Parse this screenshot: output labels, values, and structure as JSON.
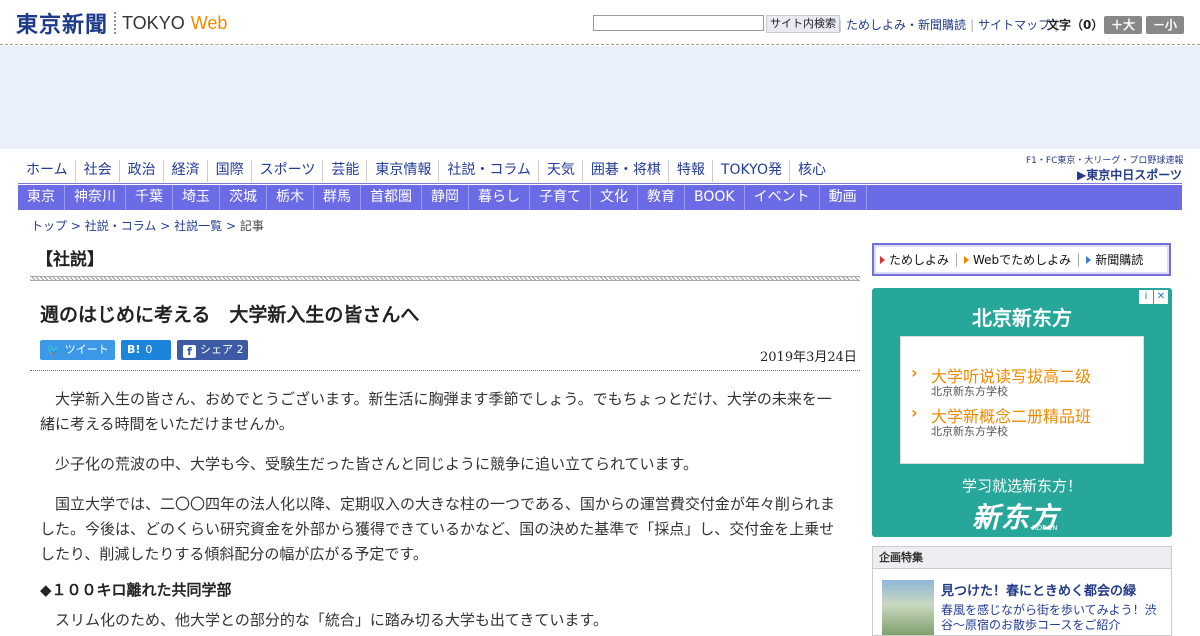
{
  "header": {
    "logo_ja": "東京新聞",
    "logo_en1": "TOKYO",
    "logo_en2": "Web",
    "search_placeholder": "",
    "search_button": "サイト内検索",
    "links": [
      "ためしよみ・新聞購読",
      "サイトマップ"
    ],
    "font_size_label": "文字（0）",
    "font_bigger": "＋大",
    "font_smaller": "－小"
  },
  "nav_primary": [
    "ホーム",
    "社会",
    "政治",
    "経済",
    "国際",
    "スポーツ",
    "芸能",
    "東京情報",
    "社説・コラム",
    "天気",
    "囲碁・将棋",
    "特報",
    "TOKYO発",
    "核心"
  ],
  "sports_promo": {
    "line1": "F1・FC東京・大リーグ・プロ野球速報",
    "line2": "▶東京中日スポーツ"
  },
  "nav_secondary": [
    "東京",
    "神奈川",
    "千葉",
    "埼玉",
    "茨城",
    "栃木",
    "群馬",
    "首都圏",
    "静岡",
    "暮らし",
    "子育て",
    "文化",
    "教育",
    "BOOK",
    "イベント",
    "動画"
  ],
  "breadcrumb": {
    "items": [
      "トップ",
      "社説・コラム",
      "社説一覧"
    ],
    "current": "記事",
    "sep": ">"
  },
  "article": {
    "section": "【社説】",
    "headline": "週のはじめに考える　大学新入生の皆さんへ",
    "share": {
      "tweet": "ツイート",
      "hatena_icon": "B!",
      "hatena_count": "0",
      "facebook_label": "シェア",
      "facebook_count": "2"
    },
    "date": "2019年3月24日",
    "paragraphs": [
      "　大学新入生の皆さん、おめでとうございます。新生活に胸弾ます季節でしょう。でもちょっとだけ、大学の未来を一緒に考える時間をいただけませんか。",
      "　少子化の荒波の中、大学も今、受験生だった皆さんと同じように競争に追い立てられています。",
      "　国立大学では、二〇〇四年の法人化以降、定期収入の大きな柱の一つである、国からの運営費交付金が年々削られました。今後は、どのくらい研究資金を外部から獲得できているかなど、国の決めた基準で「採点」し、交付金を上乗せしたり、削減したりする傾斜配分の幅が広がる予定です。"
    ],
    "subhead": "◆１００キロ離れた共同学部",
    "paragraph4": "　スリム化のため、他大学との部分的な「統合」に踏み切る大学も出てきています。"
  },
  "sidebar": {
    "subscribe_links": [
      "ためしよみ",
      "Webでためしよみ",
      "新聞購読"
    ],
    "ad": {
      "title": "北京新东方",
      "items": [
        {
          "title": "大学听说读写拔高二级",
          "sub": "北京新东方学校"
        },
        {
          "title": "大学新概念二册精品班",
          "sub": "北京新东方学校"
        }
      ],
      "tagline": "学习就选新东方！",
      "logo": "新东方",
      "logo_sub": "XDF.CN"
    },
    "feature": {
      "header": "企画特集",
      "title": "見つけた！春にときめく都会の緑",
      "desc": "春風を感じながら街を歩いてみよう！渋谷～原宿のお散歩コースをご紹介"
    }
  },
  "colors": {
    "nav_band": "#6b6be6",
    "link": "#233c96",
    "ad_bg": "#27a79a",
    "accent_orange": "#f08a00"
  }
}
